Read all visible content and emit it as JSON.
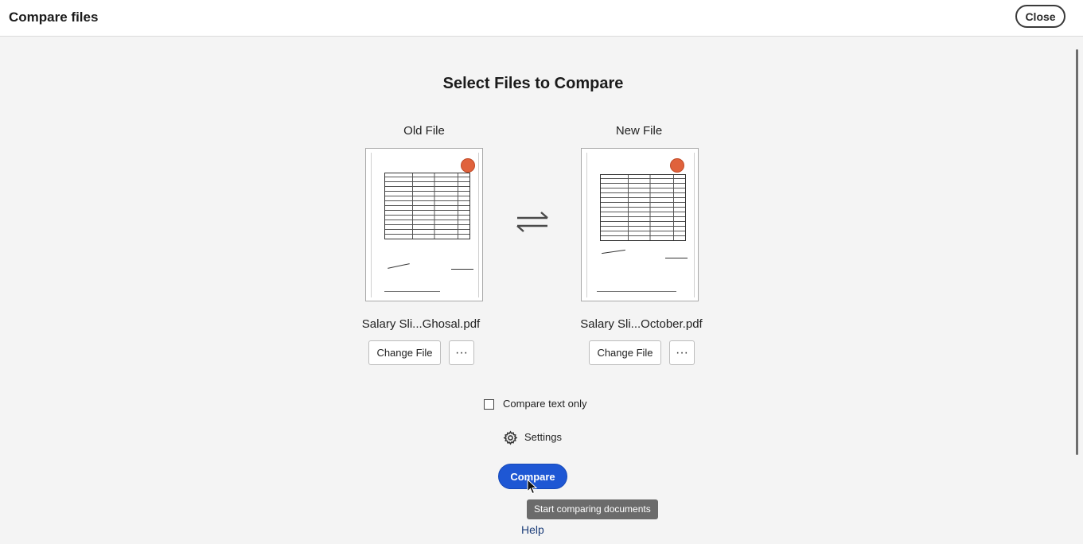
{
  "header": {
    "title": "Compare files",
    "close_label": "Close"
  },
  "main": {
    "heading": "Select Files to Compare",
    "old_file": {
      "label": "Old File",
      "file_name": "Salary Sli...Ghosal.pdf",
      "change_label": "Change File",
      "more_label": "···"
    },
    "new_file": {
      "label": "New File",
      "file_name": "Salary Sli...October.pdf",
      "change_label": "Change File",
      "more_label": "···"
    },
    "swap_icon": "swap-arrows-icon",
    "compare_text_only_label": "Compare text only",
    "compare_text_only_checked": false,
    "settings_label": "Settings",
    "compare_label": "Compare",
    "compare_tooltip": "Start comparing documents",
    "help_label": "Help"
  },
  "colors": {
    "accent": "#1e57d4",
    "tooltip_bg": "#6b6b6b",
    "background": "#f4f4f4"
  }
}
